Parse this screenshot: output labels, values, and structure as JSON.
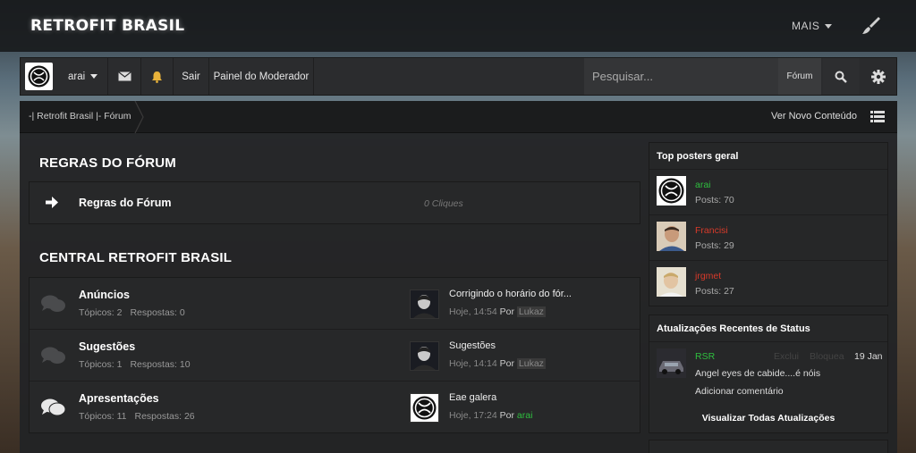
{
  "site": {
    "title": "RETROFIT BRASIL",
    "more_label": "MAIS"
  },
  "userbar": {
    "username": "arai",
    "logout_label": "Sair",
    "moderator_label": "Painel do Moderador",
    "search_placeholder": "Pesquisar...",
    "search_scope": "Fórum"
  },
  "breadcrumb": {
    "label": "-| Retrofit Brasil |- Fórum",
    "new_content": "Ver Novo Conteúdo"
  },
  "rules_section": {
    "title": "REGRAS DO FÓRUM",
    "row": {
      "title": "Regras do Fórum",
      "clicks": "0 Cliques"
    }
  },
  "central_section": {
    "title": "CENTRAL RETROFIT BRASIL",
    "forums": [
      {
        "title": "Anúncios",
        "topics": "Tópicos: 2",
        "replies": "Respostas: 0",
        "last_title": "Corrigindo o horário do fór...",
        "last_time": "Hoje, 14:54",
        "by_label": "Por",
        "last_user": "Lukaz"
      },
      {
        "title": "Sugestões",
        "topics": "Tópicos: 1",
        "replies": "Respostas: 10",
        "last_title": "Sugestões",
        "last_time": "Hoje, 14:14",
        "by_label": "Por",
        "last_user": "Lukaz"
      },
      {
        "title": "Apresentações",
        "topics": "Tópicos: 11",
        "replies": "Respostas: 26",
        "last_title": "Eae galera",
        "last_time": "Hoje, 17:24",
        "by_label": "Por",
        "last_user": "arai"
      }
    ]
  },
  "top_posters": {
    "title": "Top posters geral",
    "items": [
      {
        "name": "arai",
        "posts": "Posts: 70",
        "color": "#2fbf3f"
      },
      {
        "name": "Francisi",
        "posts": "Posts: 29",
        "color": "#d63a2a"
      },
      {
        "name": "jrgmet",
        "posts": "Posts: 27",
        "color": "#d63a2a"
      }
    ]
  },
  "status_updates": {
    "title": "Atualizações Recentes de Status",
    "user": "RSR",
    "delete_label": "Exclui",
    "block_label": "Bloquea",
    "date": "19 Jan",
    "text": "Angel eyes de cabide....é nóis",
    "comment_label": "Adicionar comentário",
    "view_all": "Visualizar Todas Atualizações"
  },
  "colors": {
    "green_user": "#2fbf3f",
    "red_user": "#d63a2a"
  }
}
